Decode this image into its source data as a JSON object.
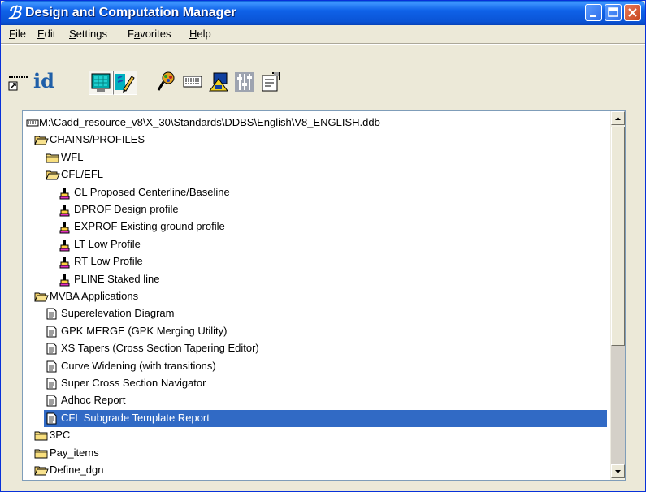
{
  "window": {
    "title": "Design and Computation Manager",
    "app_icon_glyph": "ℬ",
    "title_colors": {
      "accent": "#0A54D6",
      "close": "#C8461E"
    }
  },
  "menu": {
    "items": [
      {
        "label": "File",
        "key": "F",
        "rest": "ile"
      },
      {
        "label": "Edit",
        "key": "E",
        "rest": "dit"
      },
      {
        "label": "Settings",
        "key": "S",
        "rest": "ettings"
      },
      {
        "label": "Favorites",
        "key": "a",
        "pre": "F",
        "rest": "vorites"
      },
      {
        "label": "Help",
        "key": "H",
        "rest": "elp"
      }
    ]
  },
  "toolbar": {
    "id_label": "id",
    "tools": [
      "shortcut-icon",
      "id-icon",
      "monitor-icon",
      "pencil-edit-icon",
      "paint-brush-icon",
      "keyboard-icon",
      "display-icon",
      "sliders-icon",
      "properties-icon"
    ]
  },
  "tree": {
    "rows": [
      {
        "label": "M:\\Cadd_resource_v8\\X_30\\Standards\\DDBS\\English\\V8_ENGLISH.ddb",
        "icon": "keyboard",
        "indent": 0
      },
      {
        "label": "CHAINS/PROFILES",
        "icon": "folder-open",
        "indent": 1
      },
      {
        "label": "WFL",
        "icon": "folder-closed",
        "indent": 2
      },
      {
        "label": "CFL/EFL",
        "icon": "folder-open",
        "indent": 2
      },
      {
        "label": "CL Proposed Centerline/Baseline",
        "icon": "brush",
        "indent": 3
      },
      {
        "label": "DPROF Design profile",
        "icon": "brush",
        "indent": 3
      },
      {
        "label": "EXPROF Existing ground profile",
        "icon": "brush",
        "indent": 3
      },
      {
        "label": "LT Low Profile",
        "icon": "brush",
        "indent": 3
      },
      {
        "label": "RT Low Profile",
        "icon": "brush",
        "indent": 3
      },
      {
        "label": "PLINE Staked line",
        "icon": "brush",
        "indent": 3
      },
      {
        "label": "MVBA Applications",
        "icon": "folder-open",
        "indent": 1
      },
      {
        "label": "Superelevation Diagram",
        "icon": "document",
        "indent": 2
      },
      {
        "label": "GPK MERGE (GPK Merging Utility)",
        "icon": "document",
        "indent": 2
      },
      {
        "label": "XS Tapers (Cross Section Tapering Editor)",
        "icon": "document",
        "indent": 2
      },
      {
        "label": "Curve Widening (with transitions)",
        "icon": "document",
        "indent": 2
      },
      {
        "label": "Super Cross Section Navigator",
        "icon": "document",
        "indent": 2
      },
      {
        "label": "Adhoc Report",
        "icon": "document",
        "indent": 2
      },
      {
        "label": "CFL Subgrade Template Report",
        "icon": "document",
        "indent": 2,
        "selected": true
      },
      {
        "label": "3PC",
        "icon": "folder-closed",
        "indent": 1
      },
      {
        "label": "Pay_items",
        "icon": "folder-closed",
        "indent": 1
      },
      {
        "label": "Define_dgn",
        "icon": "folder-open",
        "indent": 1
      }
    ],
    "selection_color": "#316AC5"
  }
}
